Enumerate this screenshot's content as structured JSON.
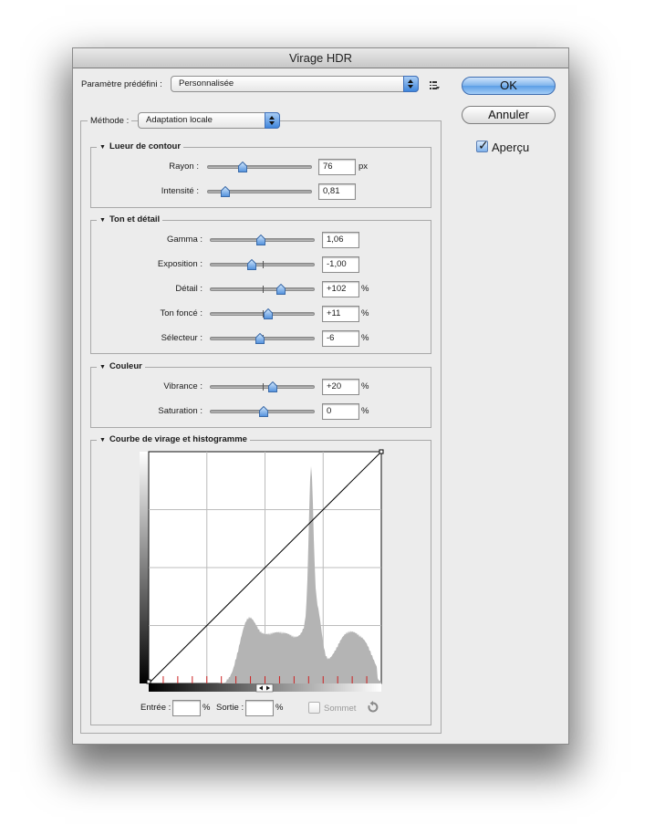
{
  "window": {
    "title": "Virage HDR"
  },
  "preset": {
    "label": "Paramètre prédéfini :",
    "value": "Personnalisée",
    "menu_icon": "list-menu-icon"
  },
  "buttons": {
    "ok": "OK",
    "cancel": "Annuler"
  },
  "preview": {
    "label": "Aperçu",
    "checked": true
  },
  "method": {
    "label": "Méthode :",
    "value": "Adaptation locale"
  },
  "edge_glow": {
    "title": "Lueur de contour",
    "radius": {
      "label": "Rayon :",
      "value": "76",
      "unit": "px",
      "fraction": 0.34
    },
    "strength": {
      "label": "Intensité :",
      "value": "0,81",
      "fraction": 0.17
    }
  },
  "tone_detail": {
    "title": "Ton et détail",
    "gamma": {
      "label": "Gamma :",
      "value": "1,06",
      "unit": "",
      "fraction": 0.49
    },
    "exposure": {
      "label": "Exposition :",
      "value": "-1,00",
      "unit": "",
      "fraction": 0.4
    },
    "detail": {
      "label": "Détail :",
      "value": "+102",
      "unit": "%",
      "fraction": 0.68
    },
    "shadow": {
      "label": "Ton foncé :",
      "value": "+11",
      "unit": "%",
      "fraction": 0.56
    },
    "highlight": {
      "label": "Sélecteur :",
      "value": "-6",
      "unit": "%",
      "fraction": 0.48
    }
  },
  "color": {
    "title": "Couleur",
    "vibrance": {
      "label": "Vibrance :",
      "value": "+20",
      "unit": "%",
      "fraction": 0.6
    },
    "saturation": {
      "label": "Saturation :",
      "value": "0",
      "unit": "%",
      "fraction": 0.51
    }
  },
  "curve": {
    "title": "Courbe de virage et histogramme",
    "input_label": "Entrée :",
    "input_value": "",
    "output_label": "Sortie :",
    "output_value": "",
    "percent": "%",
    "corner_label": "Sommet",
    "corner_checked": false,
    "reset_icon": "reset-icon"
  },
  "colors": {
    "accent": "#5c9ee6",
    "window_bg": "#ececec",
    "histogram": "#b4b4b4",
    "red_tick": "#cc2222"
  }
}
